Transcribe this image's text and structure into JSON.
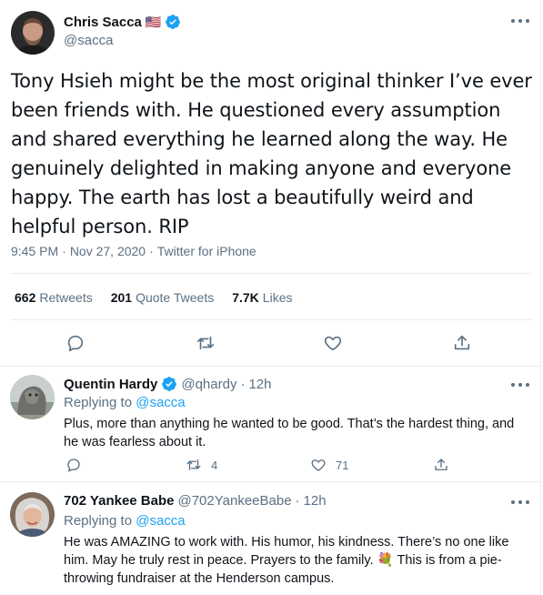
{
  "main_tweet": {
    "author": {
      "name": "Chris Sacca",
      "handle": "@sacca",
      "flag": "🇺🇸"
    },
    "text": "Tony Hsieh might be the most original thinker I’ve ever been friends with. He questioned every assumption and shared everything he learned along the way. He genuinely delighted in making anyone and everyone happy. The earth has lost a beautifully weird and helpful person. RIP",
    "time": "9:45 PM",
    "date": "Nov 27, 2020",
    "source": "Twitter for iPhone",
    "dot": "·",
    "stats": {
      "retweets_count": "662",
      "retweets_label": "Retweets",
      "quotes_count": "201",
      "quotes_label": "Quote Tweets",
      "likes_count": "7.7K",
      "likes_label": "Likes"
    }
  },
  "replies": [
    {
      "name": "Quentin Hardy",
      "handle": "@qhardy",
      "dot": "·",
      "time": "12h",
      "replying_prefix": "Replying to",
      "replying_to": "@sacca",
      "text": "Plus, more than anything he wanted to be good. That’s the hardest thing, and he was fearless about it.",
      "retweets": "4",
      "likes": "71"
    },
    {
      "name": "702 Yankee Babe",
      "handle": "@702YankeeBabe",
      "dot": "·",
      "time": "12h",
      "replying_prefix": "Replying to",
      "replying_to": "@sacca",
      "text": "He was AMAZING to work with. His humor, his kindness. There’s no one like him. May he truly rest in peace. Prayers to the family. 💐 This is from a pie-throwing fundraiser at the Henderson campus."
    }
  ],
  "icons": {
    "verified": "verified-badge-icon",
    "reply": "reply-icon",
    "retweet": "retweet-icon",
    "like": "heart-icon",
    "share": "share-icon",
    "more": "more-options-icon"
  },
  "colors": {
    "accent": "#1da1f2",
    "muted": "#5b7083",
    "text": "#0f1419",
    "divider": "#e6ecf0"
  }
}
